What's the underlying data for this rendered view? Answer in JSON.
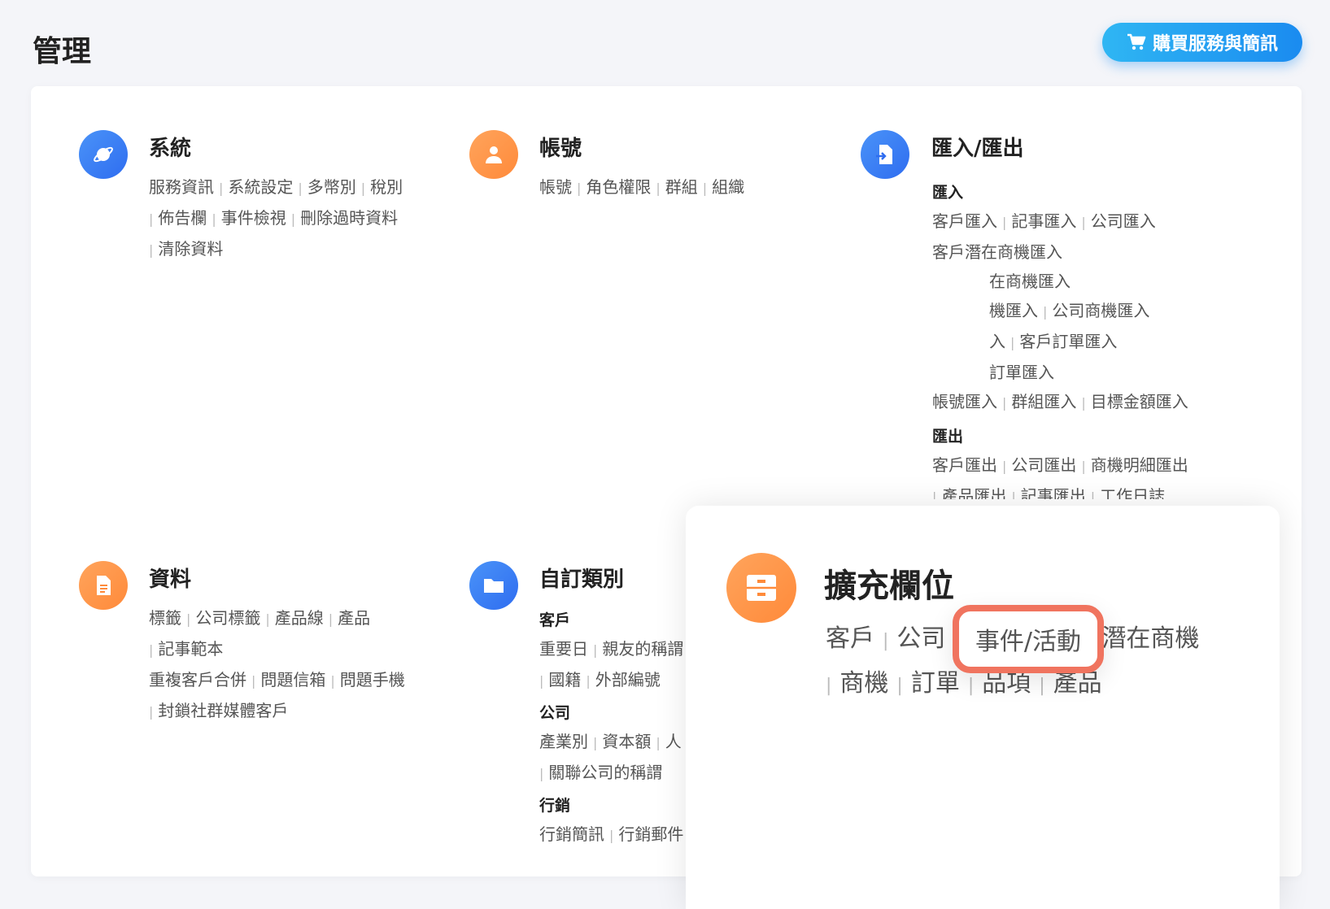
{
  "page": {
    "title": "管理"
  },
  "buy_button": {
    "label": "購買服務與簡訊"
  },
  "sections": {
    "system": {
      "title": "系統",
      "lines": [
        [
          "服務資訊",
          "系統設定",
          "多幣別",
          "稅別"
        ],
        [
          "佈告欄",
          "事件檢視",
          "刪除過時資料"
        ],
        [
          "清除資料"
        ]
      ]
    },
    "account": {
      "title": "帳號",
      "lines": [
        [
          "帳號",
          "角色權限",
          "群組",
          "組織"
        ]
      ]
    },
    "import_export": {
      "title": "匯入/匯出",
      "import_heading": "匯入",
      "import_lines": [
        [
          "客戶匯入",
          "記事匯入",
          "公司匯入"
        ],
        [
          "客戶潛在商機匯入"
        ],
        [
          "在商機匯入"
        ],
        [
          "機匯入",
          "公司商機匯入"
        ],
        [
          "入",
          "客戶訂單匯入"
        ],
        [
          "訂單匯入"
        ],
        [
          "帳號匯入",
          "群組匯入",
          "目標金額匯入"
        ]
      ],
      "export_heading": "匯出",
      "export_lines": [
        [
          "客戶匯出",
          "公司匯出",
          "商機明細匯出"
        ],
        [
          "產品匯出",
          "記事匯出",
          "工作日誌"
        ]
      ]
    },
    "data": {
      "title": "資料",
      "lines": [
        [
          "標籤",
          "公司標籤",
          "產品線",
          "產品"
        ],
        [
          "記事範本"
        ],
        [
          "重複客戶合併",
          "問題信箱",
          "問題手機"
        ],
        [
          "封鎖社群媒體客戶"
        ]
      ]
    },
    "custom": {
      "title": "自訂類別",
      "customer_heading": "客戶",
      "customer_lines": [
        [
          "重要日",
          "親友的稱謂"
        ],
        [
          "國籍",
          "外部編號"
        ]
      ],
      "company_heading": "公司",
      "company_lines": [
        [
          "產業別",
          "資本額",
          "人"
        ],
        [
          "關聯公司的稱謂"
        ]
      ],
      "marketing_heading": "行銷",
      "marketing_lines": [
        [
          "行銷簡訊",
          "行銷郵件"
        ]
      ]
    }
  },
  "popup": {
    "title": "擴充欄位",
    "row1": [
      "客戶",
      "公司"
    ],
    "highlight": "事件/活動",
    "row1_after": "潛在商機",
    "row2": [
      "商機",
      "訂單",
      "品項",
      "產品"
    ]
  }
}
